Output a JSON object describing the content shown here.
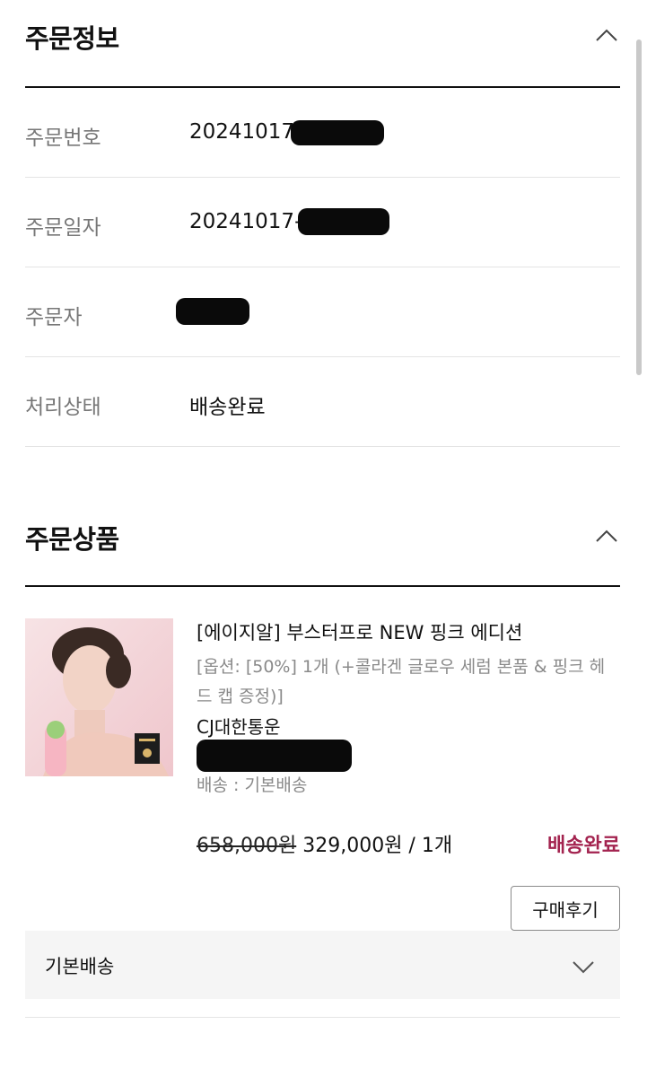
{
  "order_info": {
    "title": "주문정보",
    "rows": [
      {
        "label": "주문번호",
        "value": "20241017-"
      },
      {
        "label": "주문일자",
        "value": "20241017-("
      },
      {
        "label": "주문자",
        "value": ""
      },
      {
        "label": "처리상태",
        "value": "배송완료"
      }
    ]
  },
  "order_items": {
    "title": "주문상품",
    "product": {
      "name": "[에이지알] 부스터프로 NEW 핑크 에디션",
      "option": "[옵션: [50%] 1개 (+콜라겐 글로우 세럼 본품 & 핑크 헤드 캡 증정)]",
      "carrier": "CJ대한통운",
      "shipping": "배송 : 기본배송",
      "original_price": "658,000원",
      "price": "329,000원 / 1개",
      "status": "배송완료",
      "review_button": "구매후기"
    },
    "shipping_group": "기본배송"
  },
  "icons": {
    "collapse": "chevron-up-icon",
    "expand": "chevron-down-icon"
  },
  "colors": {
    "status_accent": "#a3234f",
    "divider": "#e4e4e4",
    "muted_text": "#777777"
  }
}
